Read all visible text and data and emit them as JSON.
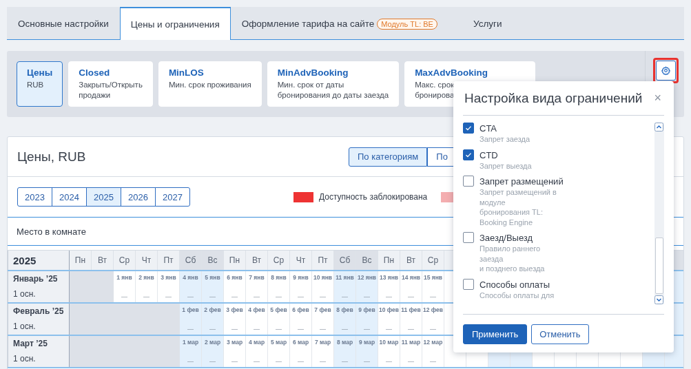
{
  "tabs": [
    {
      "label": "Основные настройки",
      "selected": false
    },
    {
      "label": "Цены и ограничения",
      "selected": true
    },
    {
      "label": "Оформление тарифа на сайте",
      "badge": "Модуль TL: BE",
      "selected": false
    },
    {
      "label": "Услуги",
      "selected": false
    }
  ],
  "modes": [
    {
      "title": "Цены",
      "lines": [
        "RUB"
      ],
      "selected": true
    },
    {
      "title": "Closed",
      "lines": [
        "Закрыть/Открыть",
        "продажи"
      ],
      "selected": false
    },
    {
      "title": "MinLOS",
      "lines": [
        "Мин. срок проживания"
      ],
      "selected": false
    },
    {
      "title": "MinAdvBooking",
      "lines": [
        "Мин. срок от даты",
        "бронирования до даты заезда"
      ],
      "selected": false
    },
    {
      "title": "MaxAdvBooking",
      "lines": [
        "Макс. срок",
        "бронирова"
      ],
      "selected": false
    }
  ],
  "card": {
    "title": "Цены, RUB",
    "view_toggle": [
      {
        "label": "По категориям",
        "selected": true
      },
      {
        "label": "По",
        "selected": false
      }
    ],
    "years": [
      {
        "label": "2023",
        "selected": false
      },
      {
        "label": "2024",
        "selected": false
      },
      {
        "label": "2025",
        "selected": true
      },
      {
        "label": "2026",
        "selected": false
      },
      {
        "label": "2027",
        "selected": false
      }
    ],
    "legend": [
      {
        "label": "Доступность заблокирована",
        "color": "#ee3333"
      },
      {
        "color": "#f4aeb0"
      }
    ],
    "room": "Место в комнате"
  },
  "calendar": {
    "year": "2025",
    "weekdays": [
      {
        "label": "Пн",
        "weekend": false
      },
      {
        "label": "Вт",
        "weekend": false
      },
      {
        "label": "Ср",
        "weekend": false
      },
      {
        "label": "Чт",
        "weekend": false
      },
      {
        "label": "Пт",
        "weekend": false
      },
      {
        "label": "Сб",
        "weekend": true
      },
      {
        "label": "Вс",
        "weekend": true
      },
      {
        "label": "Пн",
        "weekend": false
      },
      {
        "label": "Вт",
        "weekend": false
      },
      {
        "label": "Ср",
        "weekend": false
      },
      {
        "label": "Чт",
        "weekend": false
      },
      {
        "label": "Пт",
        "weekend": false
      },
      {
        "label": "Сб",
        "weekend": true
      },
      {
        "label": "Вс",
        "weekend": true
      },
      {
        "label": "Пн",
        "weekend": false
      },
      {
        "label": "Вт",
        "weekend": false
      },
      {
        "label": "Ср",
        "weekend": false
      }
    ],
    "months": [
      {
        "name": "Январь ’25",
        "sub": "1 осн.",
        "days": [
          {
            "kind": "empty"
          },
          {
            "kind": "empty"
          },
          {
            "kind": "day",
            "date": "1 янв",
            "value": "—"
          },
          {
            "kind": "day",
            "date": "2 янв",
            "value": "—"
          },
          {
            "kind": "day",
            "date": "3 янв",
            "value": "—"
          },
          {
            "kind": "day",
            "date": "4 янв",
            "value": "—"
          },
          {
            "kind": "day",
            "date": "5 янв",
            "value": "—"
          },
          {
            "kind": "day",
            "date": "6 янв",
            "value": "—"
          },
          {
            "kind": "day",
            "date": "7 янв",
            "value": "—"
          },
          {
            "kind": "day",
            "date": "8 янв",
            "value": "—"
          },
          {
            "kind": "day",
            "date": "9 янв",
            "value": "—"
          },
          {
            "kind": "day",
            "date": "10 янв",
            "value": "—"
          },
          {
            "kind": "day",
            "date": "11 янв",
            "value": "—"
          },
          {
            "kind": "day",
            "date": "12 янв",
            "value": "—"
          },
          {
            "kind": "day",
            "date": "13 янв",
            "value": "—"
          },
          {
            "kind": "day",
            "date": "14 янв",
            "value": "—"
          },
          {
            "kind": "day",
            "date": "15 янв",
            "value": "—"
          }
        ]
      },
      {
        "name": "Февраль ’25",
        "sub": "1 осн.",
        "days": [
          {
            "kind": "empty"
          },
          {
            "kind": "empty"
          },
          {
            "kind": "empty"
          },
          {
            "kind": "empty"
          },
          {
            "kind": "empty"
          },
          {
            "kind": "day",
            "date": "1 фев",
            "value": "—"
          },
          {
            "kind": "day",
            "date": "2 фев",
            "value": "—"
          },
          {
            "kind": "day",
            "date": "3 фев",
            "value": "—"
          },
          {
            "kind": "day",
            "date": "4 фев",
            "value": "—"
          },
          {
            "kind": "day",
            "date": "5 фев",
            "value": "—"
          },
          {
            "kind": "day",
            "date": "6 фев",
            "value": "—"
          },
          {
            "kind": "day",
            "date": "7 фев",
            "value": "—"
          },
          {
            "kind": "day",
            "date": "8 фев",
            "value": "—"
          },
          {
            "kind": "day",
            "date": "9 фев",
            "value": "—"
          },
          {
            "kind": "day",
            "date": "10 фев",
            "value": "—"
          },
          {
            "kind": "day",
            "date": "11 фев",
            "value": "—"
          },
          {
            "kind": "day",
            "date": "12 фев",
            "value": "—"
          }
        ]
      },
      {
        "name": "Март ’25",
        "sub": "1 осн.",
        "days": [
          {
            "kind": "empty"
          },
          {
            "kind": "empty"
          },
          {
            "kind": "empty"
          },
          {
            "kind": "empty"
          },
          {
            "kind": "empty"
          },
          {
            "kind": "day",
            "date": "1 мар",
            "value": "—"
          },
          {
            "kind": "day",
            "date": "2 мар",
            "value": "—"
          },
          {
            "kind": "day",
            "date": "3 мар",
            "value": "—"
          },
          {
            "kind": "day",
            "date": "4 мар",
            "value": "—"
          },
          {
            "kind": "day",
            "date": "5 мар",
            "value": "—"
          },
          {
            "kind": "day",
            "date": "6 мар",
            "value": "—"
          },
          {
            "kind": "day",
            "date": "7 мар",
            "value": "—"
          },
          {
            "kind": "day",
            "date": "8 мар",
            "value": "—"
          },
          {
            "kind": "day",
            "date": "9 мар",
            "value": "—"
          },
          {
            "kind": "day",
            "date": "10 мар",
            "value": "—"
          },
          {
            "kind": "day",
            "date": "11 мар",
            "value": "—"
          },
          {
            "kind": "day",
            "date": "12 мар",
            "value": "—"
          }
        ]
      }
    ]
  },
  "popup": {
    "title": "Настройка вида ограничений",
    "close": "×",
    "items": [
      {
        "label": "CTA",
        "lines": [
          "Запрет заезда"
        ],
        "checked": true
      },
      {
        "label": "CTD",
        "lines": [
          "Запрет выезда"
        ],
        "checked": true
      },
      {
        "label": "Запрет размещений",
        "lines": [
          "Запрет размещений в",
          "модуле",
          "бронирования TL:",
          "Booking Engine"
        ],
        "checked": false
      },
      {
        "label": "Заезд/Выезд",
        "lines": [
          "Правило раннего",
          "заезда",
          "и позднего выезда"
        ],
        "checked": false
      },
      {
        "label": "Способы оплаты",
        "lines": [
          "Способы оплаты для"
        ],
        "checked": false
      }
    ],
    "apply": "Применить",
    "cancel": "Отменить"
  }
}
